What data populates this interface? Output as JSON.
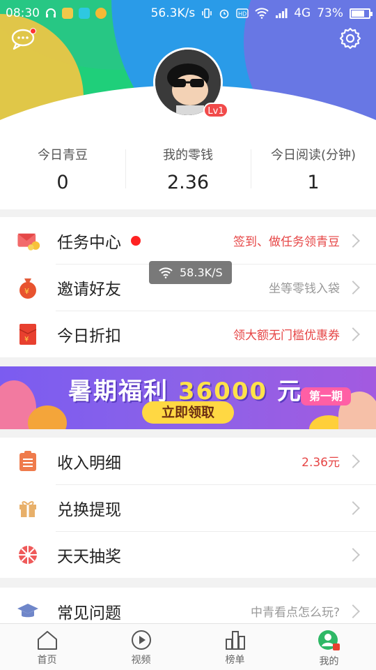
{
  "status_bar": {
    "time": "08:30",
    "speed": "56.3K/s",
    "network": "4G",
    "battery": "73%"
  },
  "profile": {
    "level": "Lv1"
  },
  "stats": [
    {
      "label": "今日青豆",
      "value": "0"
    },
    {
      "label": "我的零钱",
      "value": "2.36"
    },
    {
      "label": "今日阅读(分钟)",
      "value": "1"
    }
  ],
  "section1": [
    {
      "label": "任务中心",
      "hint": "签到、做任务领青豆",
      "icon": "task-center-icon"
    },
    {
      "label": "邀请好友",
      "hint": "坐等零钱入袋",
      "icon": "money-bag-icon"
    },
    {
      "label": "今日折扣",
      "hint": "领大额无门槛优惠券",
      "icon": "red-envelope-icon"
    }
  ],
  "banner": {
    "title_part1": "暑期福利",
    "title_number": "36000",
    "title_part2": "元",
    "tag": "第一期",
    "cta": "立即领取"
  },
  "section2": [
    {
      "label": "收入明细",
      "hint": "2.36元",
      "icon": "income-list-icon"
    },
    {
      "label": "兑换提现",
      "hint": "",
      "icon": "gift-icon"
    },
    {
      "label": "天天抽奖",
      "hint": "",
      "icon": "lottery-wheel-icon"
    }
  ],
  "section3": [
    {
      "label": "常见问题",
      "hint": "中青看点怎么玩?",
      "icon": "graduation-cap-icon"
    }
  ],
  "toast": {
    "text": "58.3K/S"
  },
  "tabbar": [
    {
      "label": "首页",
      "icon": "home-icon"
    },
    {
      "label": "视频",
      "icon": "play-icon"
    },
    {
      "label": "榜单",
      "icon": "ranking-icon"
    },
    {
      "label": "我的",
      "icon": "profile-icon"
    }
  ],
  "colors": {
    "accent_red": "#e64545",
    "header_green": "#1fcf7a",
    "header_blue": "#2a9be8"
  }
}
